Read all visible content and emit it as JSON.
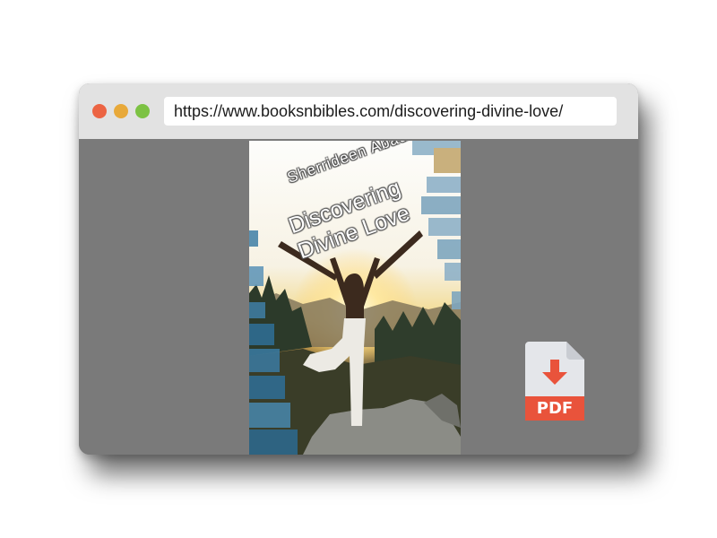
{
  "browser": {
    "url": "https://www.booksnbibles.com/discovering-divine-love/",
    "controls": [
      "close",
      "minimize",
      "maximize"
    ],
    "colors": {
      "close": "#ec6443",
      "minimize": "#e8a93a",
      "maximize": "#7cc243"
    }
  },
  "book": {
    "author": "Sherrideen Abadeen",
    "title": "Discovering Divine Love"
  },
  "download": {
    "label": "PDF",
    "icon": "download-arrow-icon",
    "accent": "#e9533b"
  }
}
